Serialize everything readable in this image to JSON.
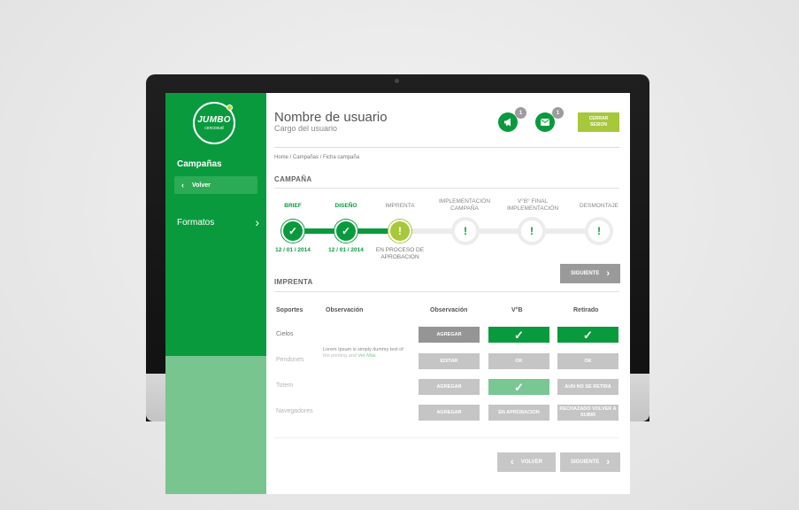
{
  "sidebar": {
    "logo_main": "JUMBO",
    "logo_sub": "cencosud",
    "title": "Campañas",
    "back_label": "Volver",
    "back_chevron": "‹",
    "formatos_label": "Formatos",
    "formatos_chevron": "›"
  },
  "header": {
    "user_name": "Nombre de usuario",
    "user_role": "Cargo del usuario",
    "notifications_badge": "1",
    "messages_badge": "1",
    "logout_label": "CERRAR SESION"
  },
  "breadcrumb": "Home / Campañas / Ficha campaña",
  "campaign": {
    "section_title": "CAMPAÑA",
    "steps": [
      {
        "label": "BRIEF",
        "state": "done",
        "date": "12 / 01 / 2014"
      },
      {
        "label": "DISEÑO",
        "state": "done",
        "date": "12 / 01 / 2014"
      },
      {
        "label": "IMPRENTA",
        "state": "active",
        "status": "EN PROCESO DE APROBACION"
      },
      {
        "label": "IMPLEMENTACIÓN CAMPAÑA",
        "state": "pending"
      },
      {
        "label": "V°B° FINAL IMPLEMENTACIÓN",
        "state": "pending"
      },
      {
        "label": "DESMONTAJE",
        "state": "pending"
      }
    ],
    "next_label": "SIGUIENTE"
  },
  "imprenta": {
    "section_title": "IMPRENTA",
    "headers": [
      "Soportes",
      "Observación",
      "Observación",
      "V°B",
      "Retirado"
    ],
    "rows": [
      {
        "label": "Cielos",
        "note": "",
        "note_link": "",
        "obs": "AGREGAR",
        "vb": "✓",
        "retirado": "✓"
      },
      {
        "label": "Pendones",
        "note": "Lorem Ipsum is simply dummy text of the printing and",
        "note_link": "Ver Más",
        "obs": "EDITAR",
        "vb": "OK",
        "retirado": "OK"
      },
      {
        "label": "Totem",
        "note": "",
        "note_link": "",
        "obs": "AGREGAR",
        "vb": "✓",
        "retirado": "AUN NO SE RETIRA"
      },
      {
        "label": "Navegadores",
        "note": "",
        "note_link": "",
        "obs": "AGREGAR",
        "vb": "EN APROBACION",
        "retirado": "RECHAZADO VOLVER A SUBIR"
      }
    ],
    "back_label": "VOLVER",
    "next_label": "SIGUIENTE"
  },
  "colors": {
    "brand_green": "#0a9a3e",
    "accent_lime": "#a7c83a",
    "neutral_grey": "#9a9a9a"
  }
}
